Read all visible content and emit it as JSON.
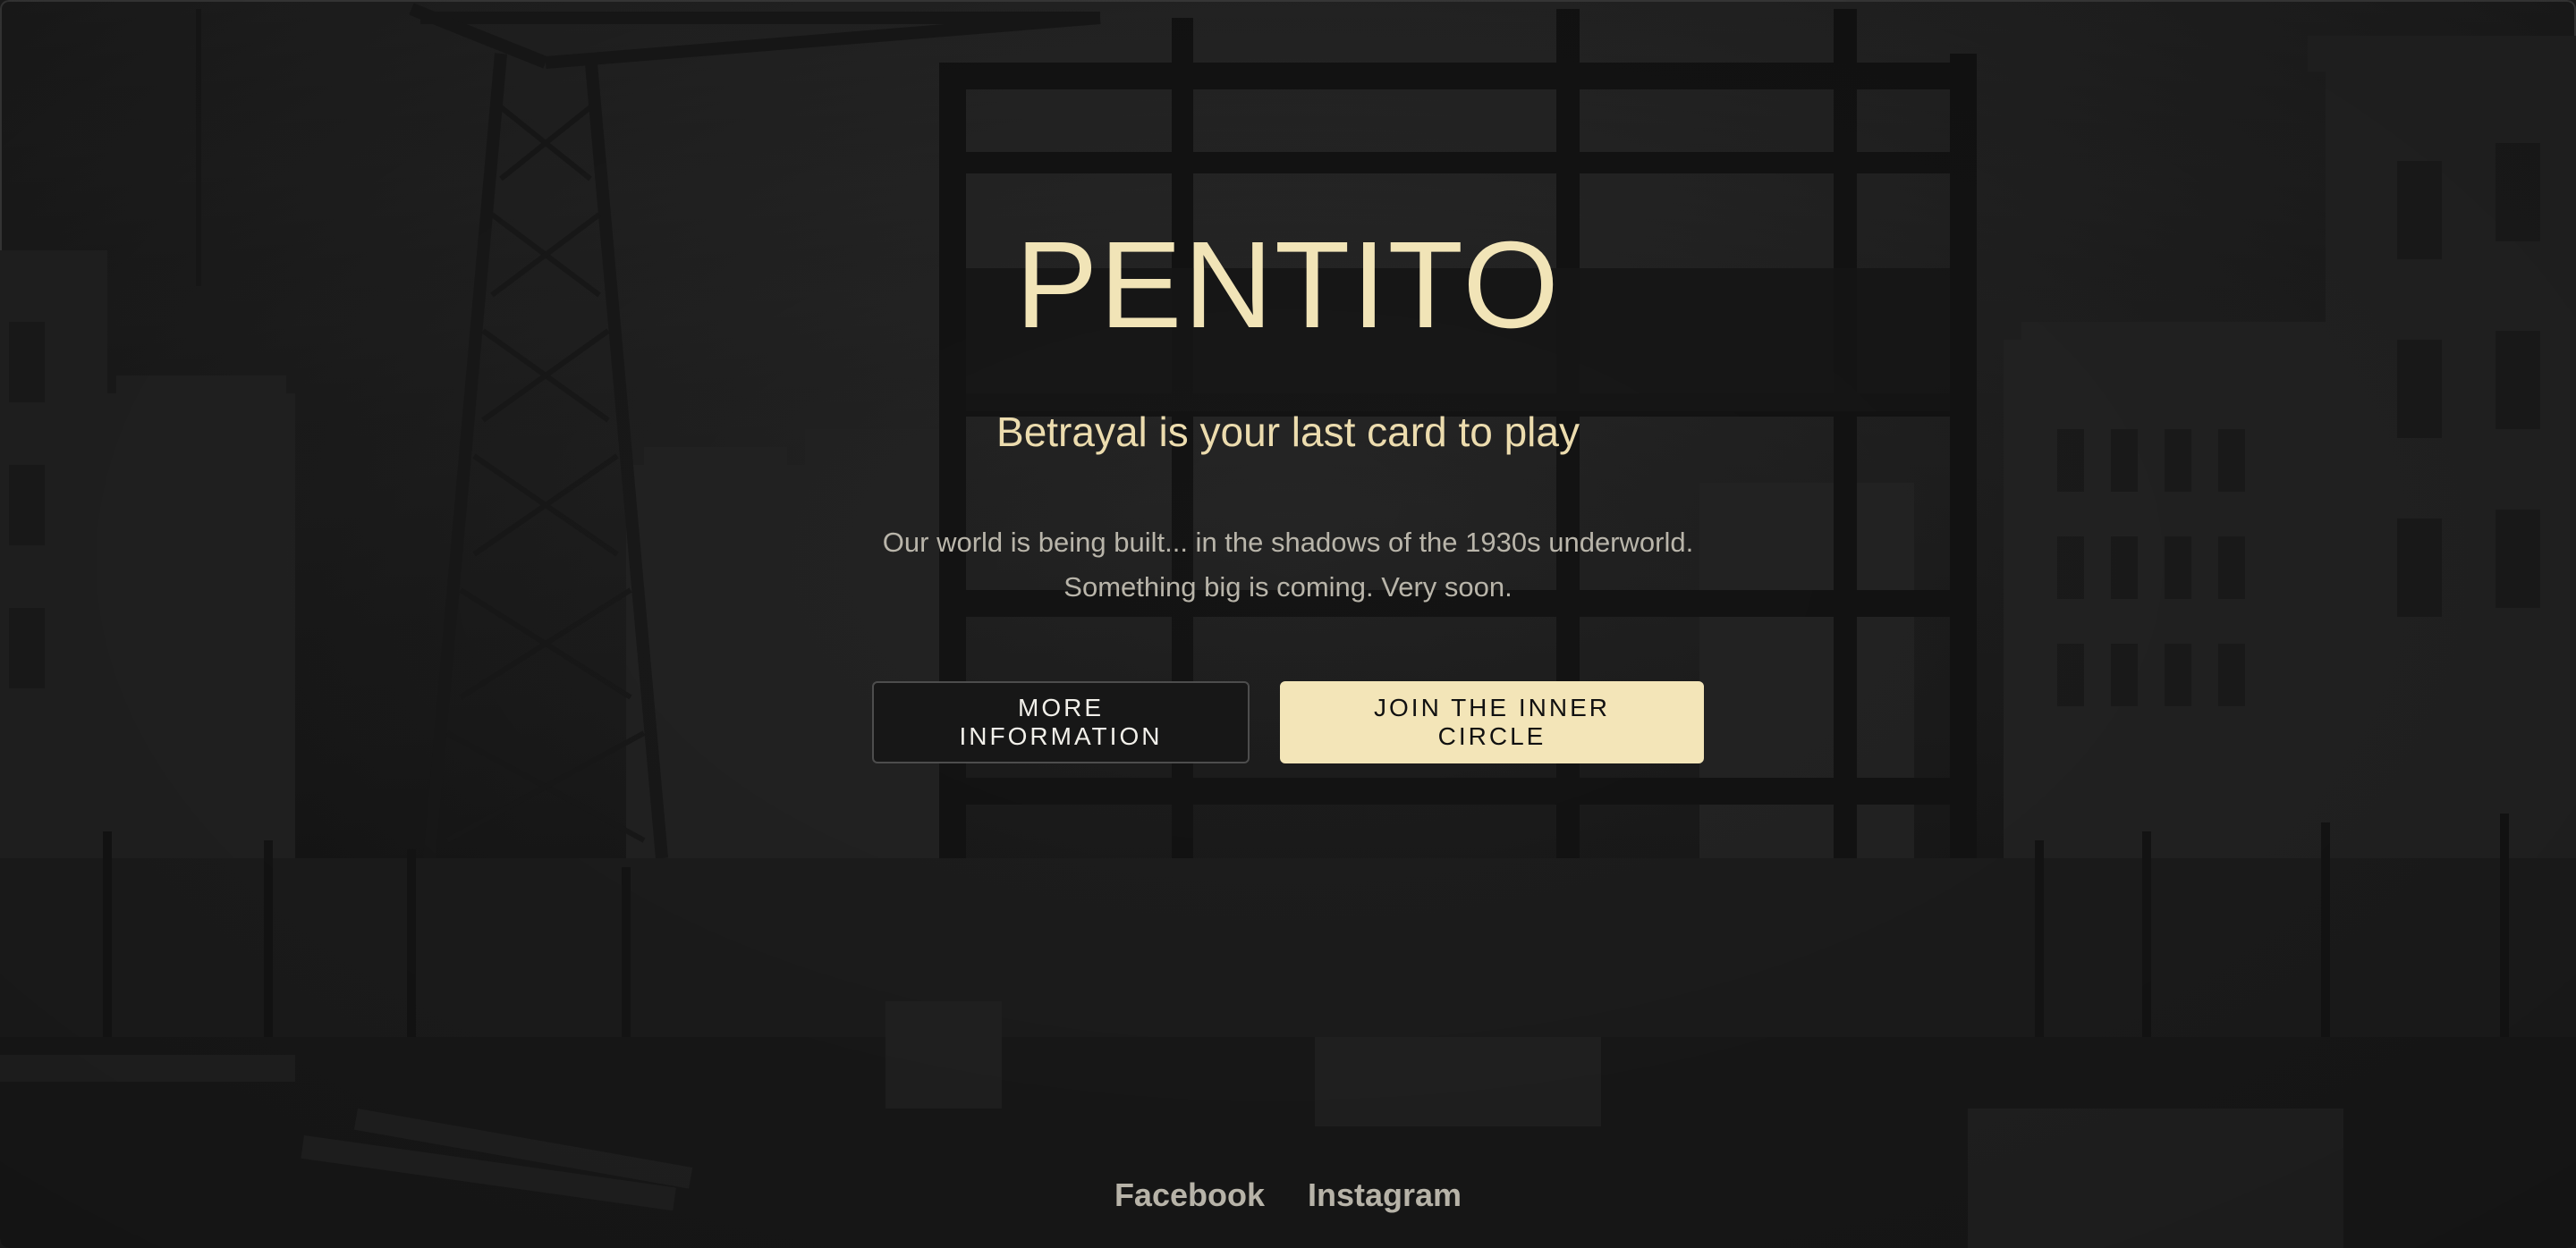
{
  "hero": {
    "title": "PENTITO",
    "tagline": "Betrayal is your last card to play",
    "description_line1": "Our world is being built... in the shadows of the 1930s underworld.",
    "description_line2": "Something big is coming. Very soon."
  },
  "actions": {
    "more_info_label": "MORE INFORMATION",
    "join_label": "JOIN THE INNER CIRCLE"
  },
  "social": {
    "facebook_label": "Facebook",
    "instagram_label": "Instagram"
  },
  "colors": {
    "accent": "#f1e4b7",
    "background": "#2a2a2a",
    "muted_text": "#b9b5aa"
  }
}
